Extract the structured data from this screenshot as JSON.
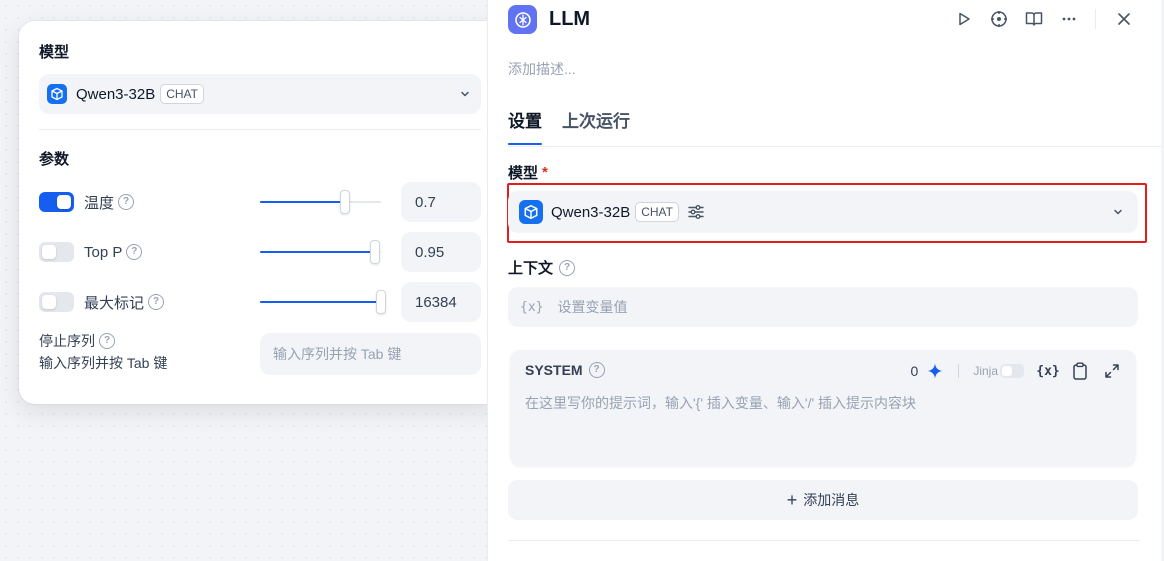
{
  "popover": {
    "model_heading": "模型",
    "model": {
      "name": "Qwen3-32B",
      "badge": "CHAT"
    },
    "params_heading": "参数",
    "params": [
      {
        "label": "温度",
        "enabled": true,
        "slider_fraction": 0.7,
        "value": "0.7"
      },
      {
        "label": "Top P",
        "enabled": false,
        "slider_fraction": 0.95,
        "value": "0.95"
      },
      {
        "label": "最大标记",
        "enabled": false,
        "slider_fraction": 1.0,
        "value": "16384"
      }
    ],
    "stop_sequence": {
      "label": "停止序列",
      "sublabel": "输入序列并按 Tab 键",
      "placeholder": "输入序列并按 Tab 键"
    }
  },
  "panel": {
    "title": "LLM",
    "description_placeholder": "添加描述...",
    "tabs": [
      {
        "label": "设置",
        "active": true
      },
      {
        "label": "上次运行",
        "active": false
      }
    ],
    "model_label": "模型",
    "required_mark": "*",
    "model": {
      "name": "Qwen3-32B",
      "badge": "CHAT"
    },
    "context_label": "上下文",
    "context_placeholder": "设置变量值",
    "var_icon": "{x}",
    "system": {
      "title": "SYSTEM",
      "count": "0",
      "jinja_label": "Jinja",
      "var_icon": "{x}",
      "placeholder": "在这里写你的提示词，输入'{' 插入变量、输入'/' 插入提示内容块"
    },
    "add_message": {
      "plus": "+",
      "label": "添加消息"
    }
  },
  "colors": {
    "accent": "#155eef",
    "node_icon_bg": "#6172f3",
    "model_logo_bg": "#1570ef",
    "highlight_outline": "#e21d1d",
    "required": "#d92d20"
  },
  "icons": {
    "header": [
      "play-icon",
      "crosshair-icon",
      "book-icon",
      "more-icon",
      "close-icon"
    ],
    "system_tools": [
      "sparkle-icon",
      "variable-icon",
      "clipboard-icon",
      "expand-icon"
    ]
  }
}
